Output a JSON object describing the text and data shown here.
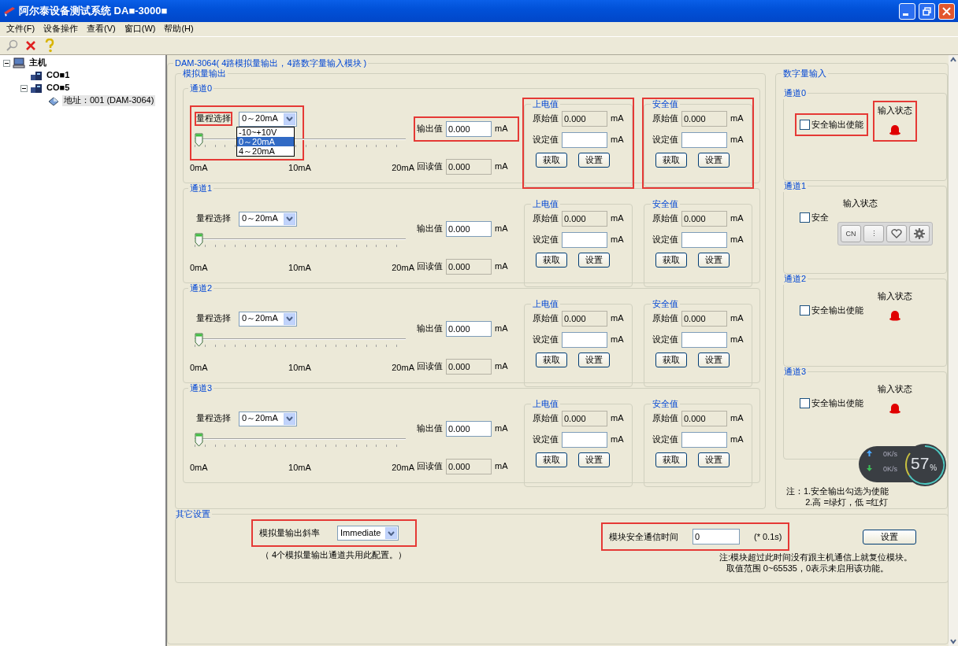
{
  "window": {
    "title": "阿尔泰设备测试系统 DA■-3000■"
  },
  "menu": [
    "文件(F)",
    "设备操作",
    "查看(V)",
    "窗口(W)",
    "帮助(H)"
  ],
  "toolbar": [
    {
      "kind": "search",
      "disabled": true
    },
    {
      "kind": "delete",
      "disabled": false
    },
    {
      "kind": "help",
      "disabled": false
    }
  ],
  "tree": [
    {
      "label": "主机",
      "kind": "computer",
      "selected": false,
      "expanded": true,
      "children": [
        {
          "label": "CO■1",
          "kind": "port",
          "selected": false
        },
        {
          "label": "CO■5",
          "kind": "port",
          "selected": false,
          "expanded": true,
          "children": [
            {
              "label": "地址：001 (DAM-3064)",
              "kind": "device",
              "selected": true
            }
          ]
        }
      ]
    }
  ],
  "module": {
    "title": "DAM-3064( 4路模拟量输出，4路数字量输入模块 )",
    "analog": {
      "title": "模拟量输出",
      "channels": [
        {
          "title": "通道0",
          "range_label": "量程选择",
          "range_value": "0～20mA",
          "range_options": [
            {
              "label": "-10~+10V",
              "selected": false
            },
            {
              "label": "0～20mA",
              "selected": true
            },
            {
              "label": "4～20mA",
              "selected": false
            }
          ],
          "range_highlighted": true,
          "label_highlighted": true,
          "level": 0,
          "scale": [
            "0mA",
            "10mA",
            "20mA"
          ],
          "output_label": "输出值",
          "output_value": "0.000",
          "output_unit": "mA",
          "output_highlighted": true,
          "readback_label": "回读值",
          "readback_value": "0.000",
          "readback_unit": "mA",
          "power_on": {
            "title": "上电值",
            "raw_label": "原始值",
            "raw_value": "0.000",
            "raw_unit": "mA",
            "set_label": "设定值",
            "set_unit": "mA",
            "buttons": [
              "获取",
              "设置"
            ],
            "highlighted": true
          },
          "safe": {
            "title": "安全值",
            "raw_label": "原始值",
            "raw_value": "0.000",
            "raw_unit": "mA",
            "set_label": "设定值",
            "set_unit": "mA",
            "buttons": [
              "获取",
              "设置"
            ],
            "highlighted": true
          }
        },
        {
          "title": "通道1",
          "range_label": "量程选择",
          "range_value": "0～20mA",
          "range_highlighted": false,
          "label_highlighted": false,
          "level": 0,
          "scale": [
            "0mA",
            "10mA",
            "20mA"
          ],
          "output_label": "输出值",
          "output_value": "0.000",
          "output_unit": "mA",
          "output_highlighted": false,
          "readback_label": "回读值",
          "readback_value": "0.000",
          "readback_unit": "mA",
          "power_on": {
            "title": "上电值",
            "raw_label": "原始值",
            "raw_value": "0.000",
            "raw_unit": "mA",
            "set_label": "设定值",
            "set_unit": "mA",
            "buttons": [
              "获取",
              "设置"
            ],
            "highlighted": false
          },
          "safe": {
            "title": "安全值",
            "raw_label": "原始值",
            "raw_value": "0.000",
            "raw_unit": "mA",
            "set_label": "设定值",
            "set_unit": "mA",
            "buttons": [
              "获取",
              "设置"
            ],
            "highlighted": false
          }
        },
        {
          "title": "通道2",
          "range_label": "量程选择",
          "range_value": "0～20mA",
          "range_highlighted": false,
          "label_highlighted": false,
          "level": 0,
          "scale": [
            "0mA",
            "10mA",
            "20mA"
          ],
          "output_label": "输出值",
          "output_value": "0.000",
          "output_unit": "mA",
          "output_highlighted": false,
          "readback_label": "回读值",
          "readback_value": "0.000",
          "readback_unit": "mA",
          "power_on": {
            "title": "上电值",
            "raw_label": "原始值",
            "raw_value": "0.000",
            "raw_unit": "mA",
            "set_label": "设定值",
            "set_unit": "mA",
            "buttons": [
              "获取",
              "设置"
            ],
            "highlighted": false
          },
          "safe": {
            "title": "安全值",
            "raw_label": "原始值",
            "raw_value": "0.000",
            "raw_unit": "mA",
            "set_label": "设定值",
            "set_unit": "mA",
            "buttons": [
              "获取",
              "设置"
            ],
            "highlighted": false
          }
        },
        {
          "title": "通道3",
          "range_label": "量程选择",
          "range_value": "0～20mA",
          "range_highlighted": false,
          "label_highlighted": false,
          "level": 0,
          "scale": [
            "0mA",
            "10mA",
            "20mA"
          ],
          "output_label": "输出值",
          "output_value": "0.000",
          "output_unit": "mA",
          "output_highlighted": false,
          "readback_label": "回读值",
          "readback_value": "0.000",
          "readback_unit": "mA",
          "power_on": {
            "title": "上电值",
            "raw_label": "原始值",
            "raw_value": "0.000",
            "raw_unit": "mA",
            "set_label": "设定值",
            "set_unit": "mA",
            "buttons": [
              "获取",
              "设置"
            ],
            "highlighted": false
          },
          "safe": {
            "title": "安全值",
            "raw_label": "原始值",
            "raw_value": "0.000",
            "raw_unit": "mA",
            "set_label": "设定值",
            "set_unit": "mA",
            "buttons": [
              "获取",
              "设置"
            ],
            "highlighted": false
          }
        }
      ]
    },
    "digital": {
      "title": "数字量输入",
      "channels": [
        {
          "title": "通道0",
          "checkbox_label": "安全输出使能",
          "checked": false,
          "checkbox_highlighted": true,
          "status_label": "输入状态",
          "status_highlighted": true,
          "color": "#e00000"
        },
        {
          "title": "通道1",
          "checkbox_label": "安全",
          "checked": false,
          "checkbox_highlighted": false,
          "status_label": "输入状态",
          "status_highlighted": false
        },
        {
          "title": "通道2",
          "checkbox_label": "安全输出使能",
          "checked": false,
          "checkbox_highlighted": false,
          "status_label": "输入状态",
          "status_highlighted": false,
          "color": "#e00000"
        },
        {
          "title": "通道3",
          "checkbox_label": "安全输出使能",
          "checked": false,
          "checkbox_highlighted": false,
          "status_label": "输入状态",
          "status_highlighted": false,
          "color": "#e00000"
        }
      ],
      "note": [
        "注：1.安全输出勾选为使能",
        "2.高 =绿灯，低 =红灯"
      ]
    }
  },
  "other": {
    "title": "其它设置",
    "slope_label": "模拟量输出斜率",
    "slope_value": "Immediate",
    "slope_highlighted": true,
    "slope_note": "（ 4个模拟量输出通道共用此配置。）",
    "time_label": "模块安全通信时间",
    "time_value": "0",
    "time_unit": "(* 0.1s)",
    "time_highlighted": true,
    "button": "设置",
    "note": [
      "注:模块超过此时间没有跟主机通信上就复位模块。",
      "取值范围 0~65535，0表示未启用该功能。"
    ]
  },
  "float_toolbar": [
    {
      "kind": "text",
      "label": "CN"
    },
    {
      "kind": "text",
      "label": "⋮"
    },
    {
      "kind": "heart"
    },
    {
      "kind": "gear"
    }
  ],
  "speed_widget": {
    "upload": "0K/s",
    "download": "0K/s",
    "percent": "57",
    "unit": "%"
  }
}
